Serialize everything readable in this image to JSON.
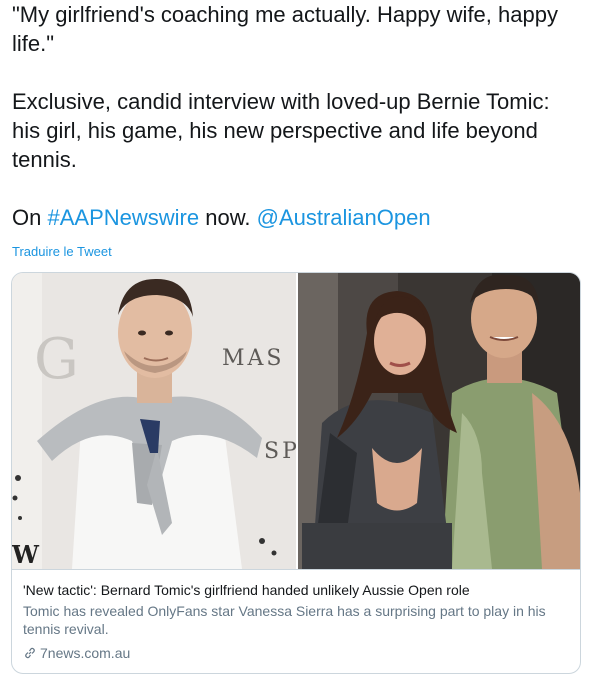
{
  "tweet": {
    "quote_line": "\"My girlfriend's coaching me actually. Happy wife, happy life.\"",
    "body_line": "Exclusive, candid interview with loved-up Bernie Tomic: his girl, his game, his new perspective and life beyond tennis.",
    "on_prefix": "On",
    "hashtag": "#AAPNewswire",
    "now_text": "now.",
    "mention": "@AustralianOpen",
    "translate_label": "Traduire le Tweet"
  },
  "card": {
    "title": "'New tactic': Bernard Tomic's girlfriend handed unlikely Aussie Open role",
    "description": "Tomic has revealed OnlyFans star Vanessa Sierra has a surprising part to play in his tennis revival.",
    "domain": "7news.com.au",
    "left_image": {
      "backdrop_letters": "G",
      "backdrop_text_1": "MAS",
      "backdrop_text_2": "SP",
      "backdrop_letter_w": "W"
    }
  },
  "colors": {
    "text": "#14171a",
    "link": "#1b95e0",
    "muted": "#657786",
    "border": "#ccd6dd"
  }
}
